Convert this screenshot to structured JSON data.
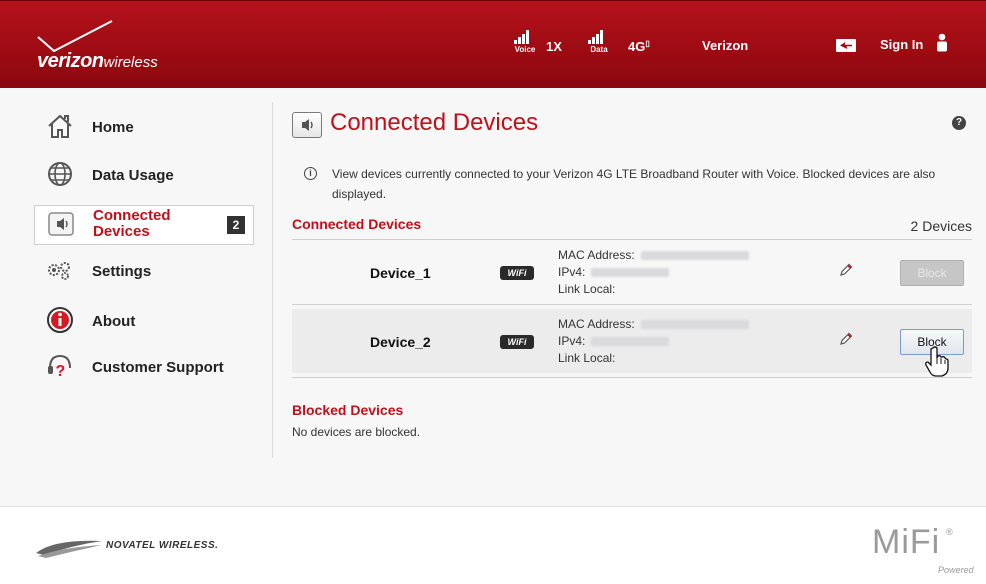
{
  "header": {
    "brand_main": "verizon",
    "brand_sub": "wireless",
    "voice_label": "Voice",
    "tech_1x": "1X",
    "data_label": "Data",
    "tech_4g": "4G",
    "carrier": "Verizon",
    "sign_in": "Sign In"
  },
  "sidebar": {
    "items": [
      {
        "label": "Home",
        "icon": "home-icon"
      },
      {
        "label": "Data Usage",
        "icon": "globe-icon"
      },
      {
        "label": "Connected Devices",
        "icon": "speaker-icon",
        "badge": "2",
        "active": true
      },
      {
        "label": "Settings",
        "icon": "gears-icon"
      },
      {
        "label": "About",
        "icon": "info-icon"
      },
      {
        "label": "Customer Support",
        "icon": "headset-icon"
      }
    ]
  },
  "main": {
    "title": "Connected Devices",
    "help": "?",
    "info_text": "View devices currently connected to your Verizon 4G LTE Broadband Router with Voice. Blocked devices are also displayed.",
    "connected_heading": "Connected Devices",
    "device_count": "2 Devices",
    "devices": [
      {
        "name": "Device_1",
        "conn": "WiFi",
        "mac_label": "MAC Address:",
        "ipv4_label": "IPv4:",
        "link_label": "Link Local:",
        "button": "Block",
        "button_state": "disabled"
      },
      {
        "name": "Device_2",
        "conn": "WiFi",
        "mac_label": "MAC Address:",
        "ipv4_label": "IPv4:",
        "link_label": "Link Local:",
        "button": "Block",
        "button_state": "active"
      }
    ],
    "blocked_heading": "Blocked Devices",
    "blocked_message": "No devices are blocked."
  },
  "footer": {
    "vendor": "NOVATEL WIRELESS.",
    "product": "MiFi",
    "product_mark": "®",
    "powered": "Powered"
  },
  "colors": {
    "brand_red": "#9d0b12",
    "accent_red": "#c0101a"
  }
}
